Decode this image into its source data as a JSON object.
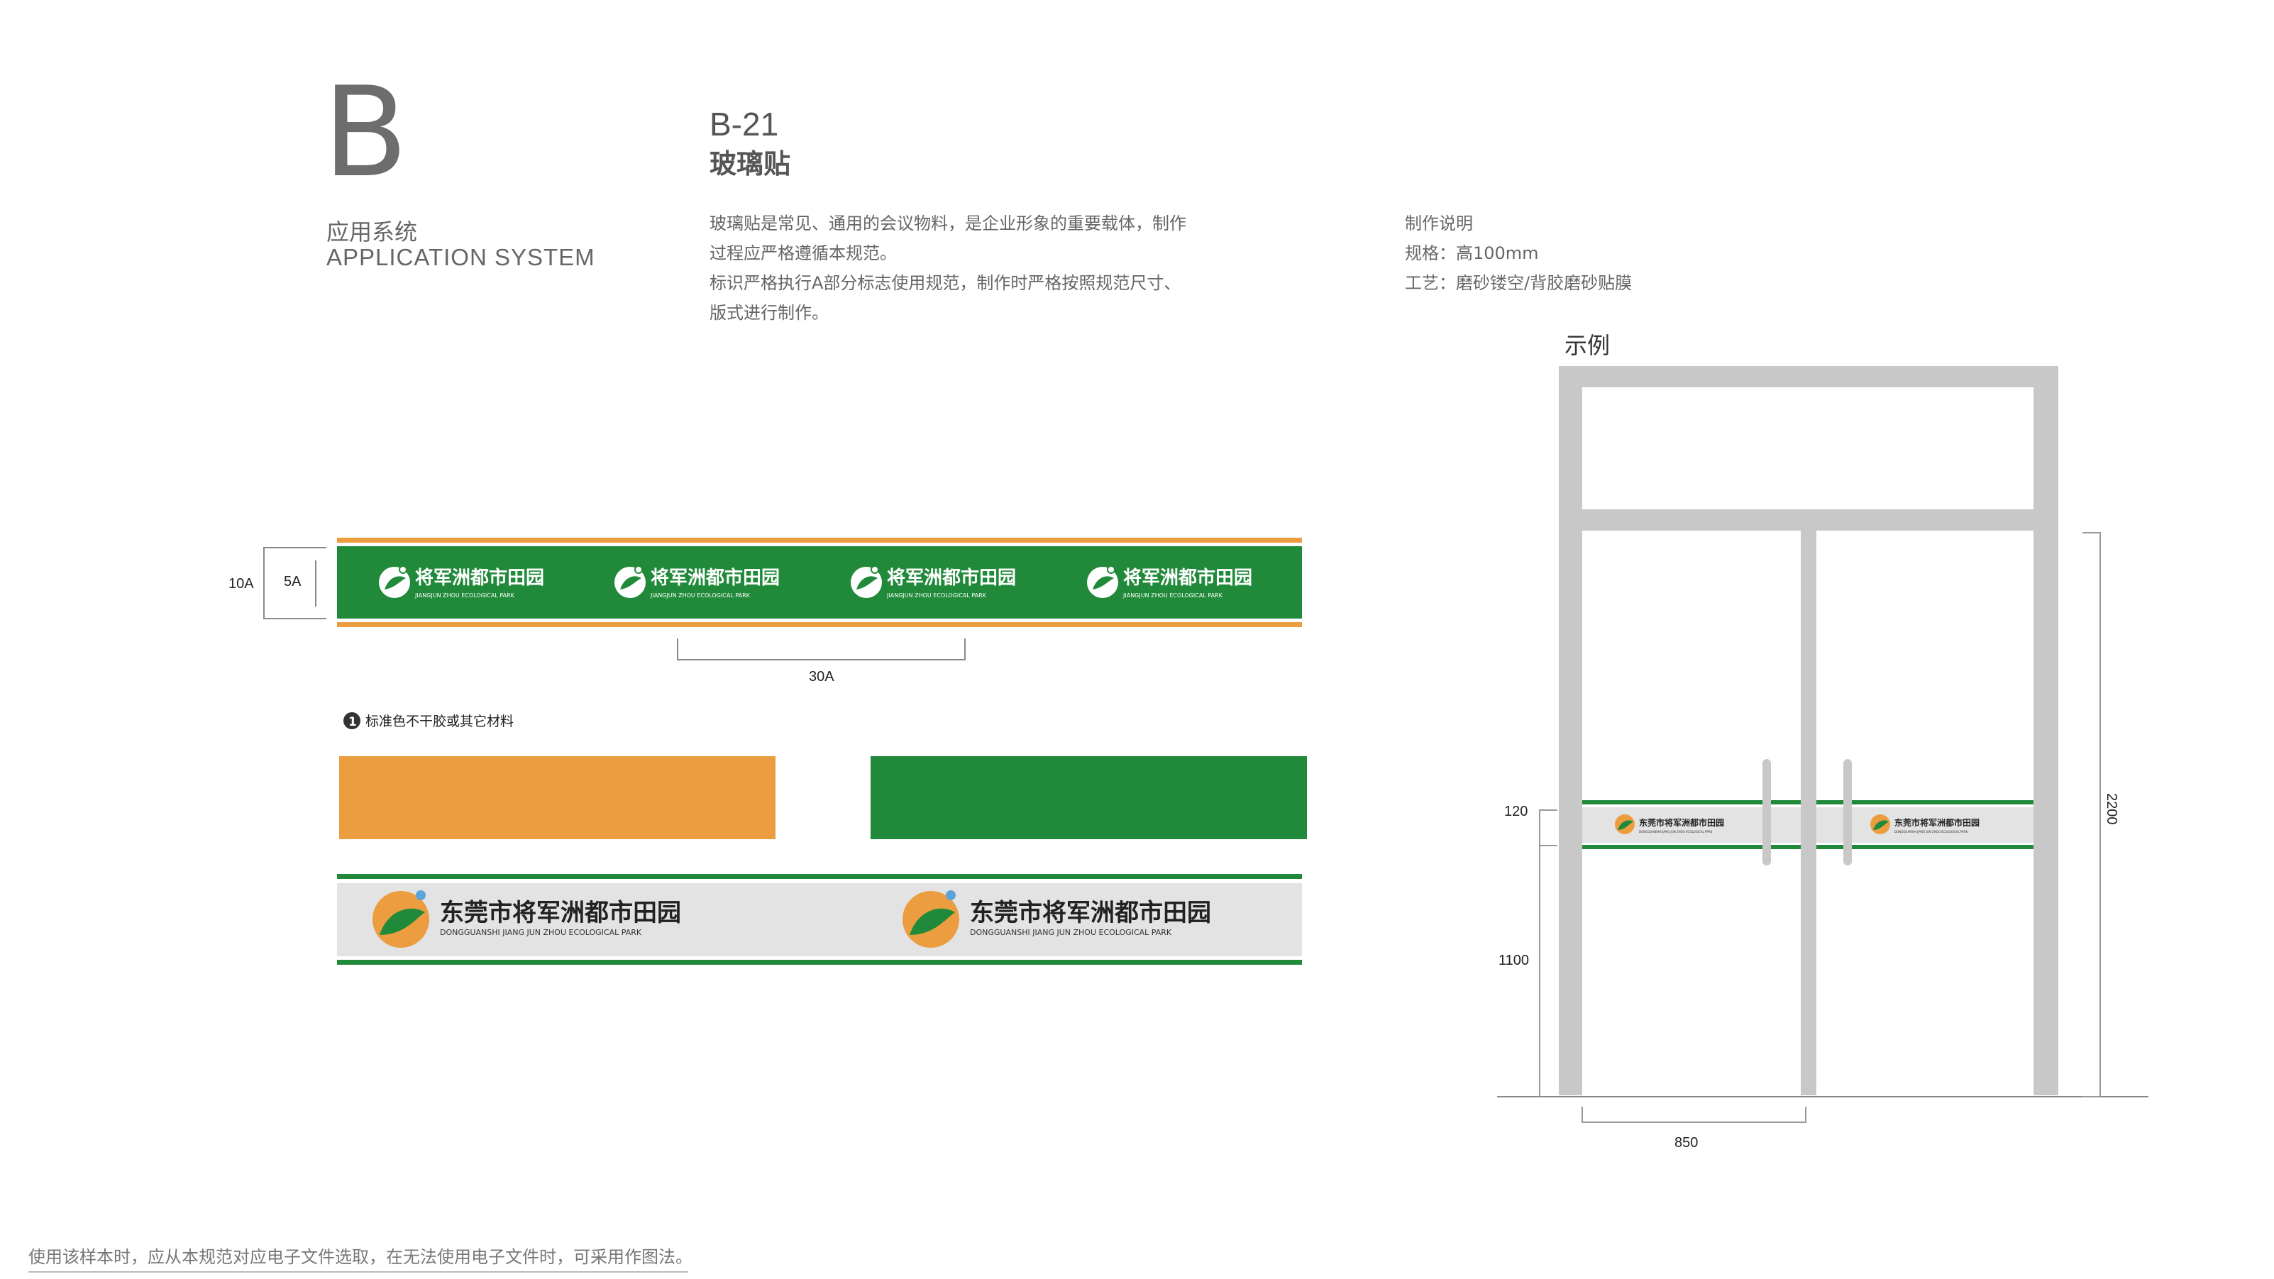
{
  "header": {
    "section_letter": "B",
    "section_cn": "应用系统",
    "section_en": "APPLICATION SYSTEM",
    "item_code": "B-21",
    "item_title": "玻璃贴"
  },
  "description": [
    "玻璃贴是常见、通用的会议物料，是企业形象的重要载体，制作",
    "过程应严格遵循本规范。",
    "标识严格执行A部分标志使用规范，制作时严格按照规范尺寸、",
    "版式进行制作。"
  ],
  "specs": {
    "heading": "制作说明",
    "size": "规格：高100mm",
    "process": "工艺：磨砂镂空/背胶磨砂贴膜"
  },
  "example_label": "示例",
  "strip_small": {
    "logo_cn": "将军洲都市田园",
    "logo_en": "JIANGJUN ZHOU ECOLOGICAL PARK",
    "dim_height_outer": "10A",
    "dim_height_inner": "5A",
    "dim_spacing": "30A"
  },
  "color_note": {
    "number": "1",
    "text": "标准色不干胶或其它材料"
  },
  "colors": {
    "orange": "#EB9D3F",
    "green": "#218A3A",
    "light_gray": "#E3E3E3",
    "frame_gray": "#C8C8C8"
  },
  "strip_large": {
    "logo_cn": "东莞市将军洲都市田园",
    "logo_en": "DONGGUANSHI JIANG JUN ZHOU ECOLOGICAL PARK"
  },
  "door": {
    "dim_band": "120",
    "dim_band_height": "1100",
    "dim_total": "2200",
    "dim_width": "850"
  },
  "footer_note": "使用该样本时，应从本规范对应电子文件选取，在无法使用电子文件时，可采用作图法。"
}
